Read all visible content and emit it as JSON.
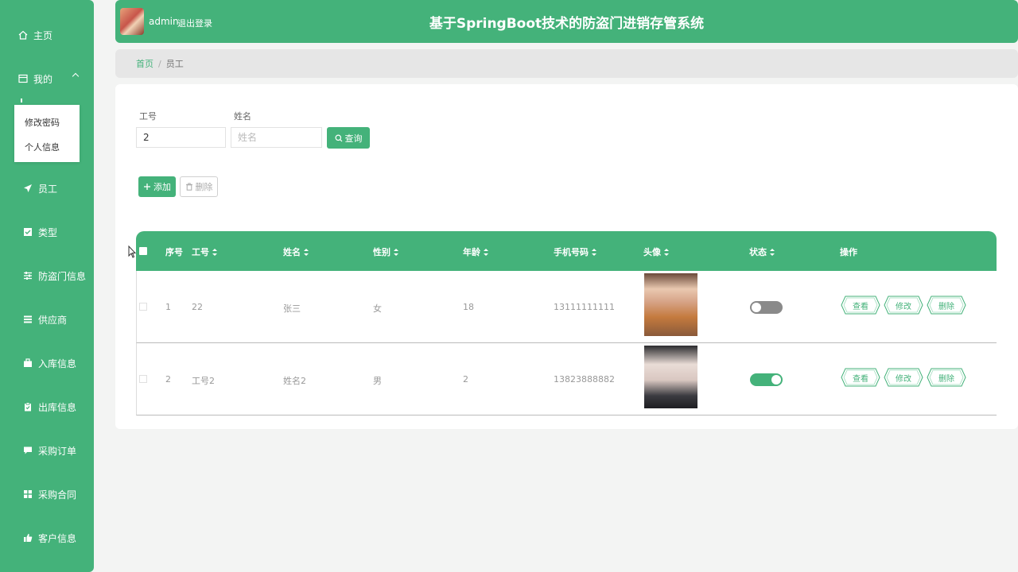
{
  "sidebar": {
    "home": "主页",
    "mine": "我的",
    "submenu": [
      "修改密码",
      "个人信息"
    ],
    "items": [
      {
        "label": "员工",
        "icon": "paper-plane-icon"
      },
      {
        "label": "类型",
        "icon": "checkbox-icon"
      },
      {
        "label": "防盗门信息",
        "icon": "sliders-icon"
      },
      {
        "label": "供应商",
        "icon": "list-icon"
      },
      {
        "label": "入库信息",
        "icon": "briefcase-icon"
      },
      {
        "label": "出库信息",
        "icon": "clipboard-icon"
      },
      {
        "label": "采购订单",
        "icon": "comment-icon"
      },
      {
        "label": "采购合同",
        "icon": "grid-icon"
      },
      {
        "label": "客户信息",
        "icon": "thumbs-up-icon"
      }
    ]
  },
  "header": {
    "user": "admin",
    "logout": "退出登录",
    "title": "基于SpringBoot技术的防盗门进销存管系统"
  },
  "breadcrumb": {
    "home": "首页",
    "sep": "/",
    "current": "员工"
  },
  "search": {
    "id_label": "工号",
    "id_value": "2",
    "name_label": "姓名",
    "name_placeholder": "姓名",
    "query_button": "查询"
  },
  "toolbar": {
    "add": "添加",
    "delete": "删除"
  },
  "table": {
    "columns": [
      "序号",
      "工号",
      "姓名",
      "性别",
      "年龄",
      "手机号码",
      "头像",
      "状态",
      "操作"
    ],
    "rows": [
      {
        "index": "1",
        "id": "22",
        "name": "张三",
        "gender": "女",
        "age": "18",
        "phone": "13111111111",
        "status": "off"
      },
      {
        "index": "2",
        "id": "工号2",
        "name": "姓名2",
        "gender": "男",
        "age": "2",
        "phone": "13823888882",
        "status": "on"
      }
    ],
    "actions": [
      "查看",
      "修改",
      "删除"
    ]
  },
  "colors": {
    "primary": "#44b27a",
    "background": "#f3f4f3",
    "toggle_off": "#8a8a8a"
  }
}
